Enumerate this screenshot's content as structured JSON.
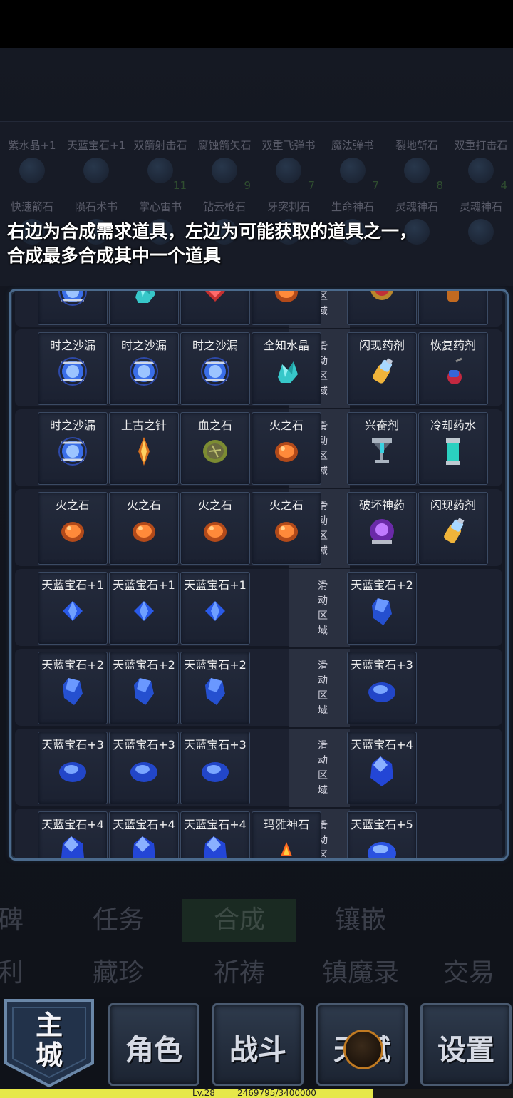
{
  "dim_items_row1": [
    {
      "name": "紫水晶+1",
      "count": ""
    },
    {
      "name": "天蓝宝石+1",
      "count": ""
    },
    {
      "name": "双箭射击石",
      "count": "11"
    },
    {
      "name": "腐蚀箭矢石",
      "count": "9"
    },
    {
      "name": "双重飞弹书",
      "count": "7"
    },
    {
      "name": "魔法弹书",
      "count": "7"
    },
    {
      "name": "裂地斩石",
      "count": "8"
    },
    {
      "name": "双重打击石",
      "count": "4"
    }
  ],
  "dim_items_row2": [
    {
      "name": "快速箭石"
    },
    {
      "name": "陨石术书"
    },
    {
      "name": "掌心雷书"
    },
    {
      "name": "钻云枪石"
    },
    {
      "name": "牙突刺石"
    },
    {
      "name": "生命神石"
    },
    {
      "name": "灵魂神石"
    },
    {
      "name": "灵魂神石"
    }
  ],
  "hint": {
    "line1": "右边为合成需求道具，左边为可能获取的道具之一，",
    "line2": "合成最多合成其中一个道具"
  },
  "scroll_label": "滑动区域",
  "recipes": [
    {
      "inputs": [
        "",
        "",
        "",
        ""
      ],
      "outputs": [
        "",
        ""
      ],
      "icons": [
        "hourglass",
        "crystal",
        "gem-red",
        "fire"
      ],
      "out_icons": [
        "ring",
        "bottle-orange"
      ]
    },
    {
      "inputs": [
        "时之沙漏",
        "时之沙漏",
        "时之沙漏",
        "全知水晶"
      ],
      "outputs": [
        "闪现药剂",
        "恢复药剂"
      ],
      "icons": [
        "hourglass",
        "hourglass",
        "hourglass",
        "crystal"
      ],
      "out_icons": [
        "bottle-blue",
        "potion-red"
      ]
    },
    {
      "inputs": [
        "时之沙漏",
        "上古之针",
        "血之石",
        "火之石"
      ],
      "outputs": [
        "兴奋剂",
        "冷却药水"
      ],
      "icons": [
        "hourglass",
        "needle",
        "blood",
        "fire"
      ],
      "out_icons": [
        "chalice",
        "vial-cyan"
      ]
    },
    {
      "inputs": [
        "火之石",
        "火之石",
        "火之石",
        "火之石"
      ],
      "outputs": [
        "破坏神药",
        "闪现药剂"
      ],
      "icons": [
        "fire",
        "fire",
        "fire",
        "fire"
      ],
      "out_icons": [
        "purple",
        "bottle-blue"
      ]
    },
    {
      "inputs": [
        "天蓝宝石+1",
        "天蓝宝石+1",
        "天蓝宝石+1",
        ""
      ],
      "outputs": [
        "天蓝宝石+2",
        ""
      ],
      "icons": [
        "gem1",
        "gem1",
        "gem1",
        ""
      ],
      "out_icons": [
        "gem2",
        ""
      ]
    },
    {
      "inputs": [
        "天蓝宝石+2",
        "天蓝宝石+2",
        "天蓝宝石+2",
        ""
      ],
      "outputs": [
        "天蓝宝石+3",
        ""
      ],
      "icons": [
        "gem2",
        "gem2",
        "gem2",
        ""
      ],
      "out_icons": [
        "gem3",
        ""
      ]
    },
    {
      "inputs": [
        "天蓝宝石+3",
        "天蓝宝石+3",
        "天蓝宝石+3",
        ""
      ],
      "outputs": [
        "天蓝宝石+4",
        ""
      ],
      "icons": [
        "gem3",
        "gem3",
        "gem3",
        ""
      ],
      "out_icons": [
        "gem4",
        ""
      ]
    },
    {
      "inputs": [
        "天蓝宝石+4",
        "天蓝宝石+4",
        "天蓝宝石+4",
        "玛雅神石"
      ],
      "outputs": [
        "天蓝宝石+5",
        ""
      ],
      "icons": [
        "gem4",
        "gem4",
        "gem4",
        "maya"
      ],
      "out_icons": [
        "gem5",
        ""
      ]
    }
  ],
  "bg_tabs": [
    "碑",
    "任务",
    "合成",
    "镶嵌",
    "利",
    "藏珍",
    "祈祷",
    "镇魔录",
    "交易"
  ],
  "nav": {
    "home": "主城",
    "role": "角色",
    "battle": "战斗",
    "talent": "天赋",
    "settings": "设置"
  },
  "xp": {
    "level": "Lv.28",
    "value": "2469795/3400000",
    "progress": 0.726
  }
}
